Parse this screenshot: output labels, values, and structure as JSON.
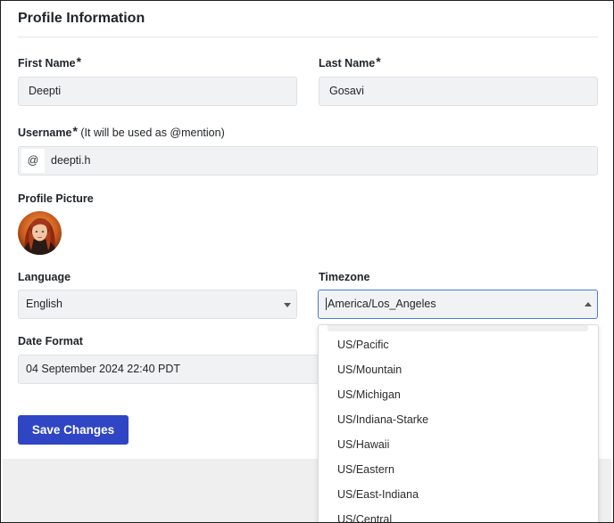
{
  "section": {
    "title": "Profile Information"
  },
  "first_name": {
    "label": "First Name",
    "required_mark": "*",
    "value": "Deepti"
  },
  "last_name": {
    "label": "Last Name",
    "required_mark": "*",
    "value": "Gosavi"
  },
  "username": {
    "label": "Username",
    "required_mark": "*",
    "hint": " (It will be used as @mention)",
    "prefix": "@",
    "value": "deepti.h"
  },
  "profile_picture": {
    "label": "Profile Picture"
  },
  "language": {
    "label": "Language",
    "selected": "English"
  },
  "timezone": {
    "label": "Timezone",
    "selected": "America/Los_Angeles",
    "options_visible": [
      "US/Pacific",
      "US/Mountain",
      "US/Michigan",
      "US/Indiana-Starke",
      "US/Hawaii",
      "US/Eastern",
      "US/East-Indiana",
      "US/Central"
    ]
  },
  "date_format": {
    "label": "Date Format",
    "selected": "04 September 2024 22:40 PDT"
  },
  "actions": {
    "save_label": "Save Changes"
  },
  "colors": {
    "primary_button": "#2f45c4",
    "focus_border": "#4a7bd8",
    "input_bg": "#f1f2f4"
  }
}
